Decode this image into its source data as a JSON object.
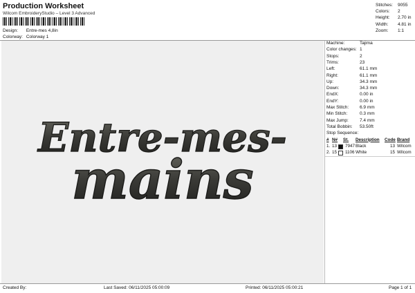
{
  "header": {
    "title": "Production Worksheet",
    "subtitle": "Wilcom EmbroideryStudio – Level 3 Advanced",
    "design_label": "Design:",
    "design_value": "Entre-mes 4,8in",
    "colorway_label": "Colorway:",
    "colorway_value": "Colorway 1"
  },
  "stats": [
    {
      "label": "Stitches:",
      "value": "9055"
    },
    {
      "label": "Colors:",
      "value": "2"
    },
    {
      "label": "Height:",
      "value": "2.70 in"
    },
    {
      "label": "Width:",
      "value": "4.81 in"
    },
    {
      "label": "Zoom:",
      "value": "1:1"
    }
  ],
  "design": {
    "line1": "Entre-mes-",
    "line2": "mains",
    "thread_color": "#3a3a36"
  },
  "properties": [
    {
      "label": "Machine:",
      "value": "Tajima"
    },
    {
      "label": "Color changes:",
      "value": "1"
    },
    {
      "label": "Stops:",
      "value": "2"
    },
    {
      "label": "Trims:",
      "value": "23"
    },
    {
      "label": "Left:",
      "value": "61.1 mm"
    },
    {
      "label": "Right:",
      "value": "61.1 mm"
    },
    {
      "label": "Up:",
      "value": "34.3 mm"
    },
    {
      "label": "Down:",
      "value": "34.3 mm"
    },
    {
      "label": "EndX:",
      "value": "0.00 in"
    },
    {
      "label": "EndY:",
      "value": "0.00 in"
    },
    {
      "label": "Max Stitch:",
      "value": "6.9 mm"
    },
    {
      "label": "Min Stitch:",
      "value": "0.3 mm"
    },
    {
      "label": "Max Jump:",
      "value": "7.4 mm"
    },
    {
      "label": "Total Bobbin:",
      "value": "53.50ft"
    }
  ],
  "stop_sequence": {
    "title": "Stop Sequence:",
    "columns": [
      "#",
      "N#",
      "St.",
      "Description",
      "Code",
      "Brand"
    ],
    "rows": [
      {
        "index": "1.",
        "needle": "13",
        "stitches": "7947",
        "description": "Black",
        "code": "13",
        "brand": "Wilcom",
        "color": "#111111"
      },
      {
        "index": "2.",
        "needle": "15",
        "stitches": "1106",
        "description": "White",
        "code": "15",
        "brand": "Wilcom",
        "color": "#ffffff"
      }
    ]
  },
  "footer": {
    "created_by": "Created By:",
    "last_saved": "Last Saved: 06/11/2025 05:00:09",
    "printed": "Printed: 06/11/2025 05:00:21",
    "page": "Page 1 of 1"
  }
}
